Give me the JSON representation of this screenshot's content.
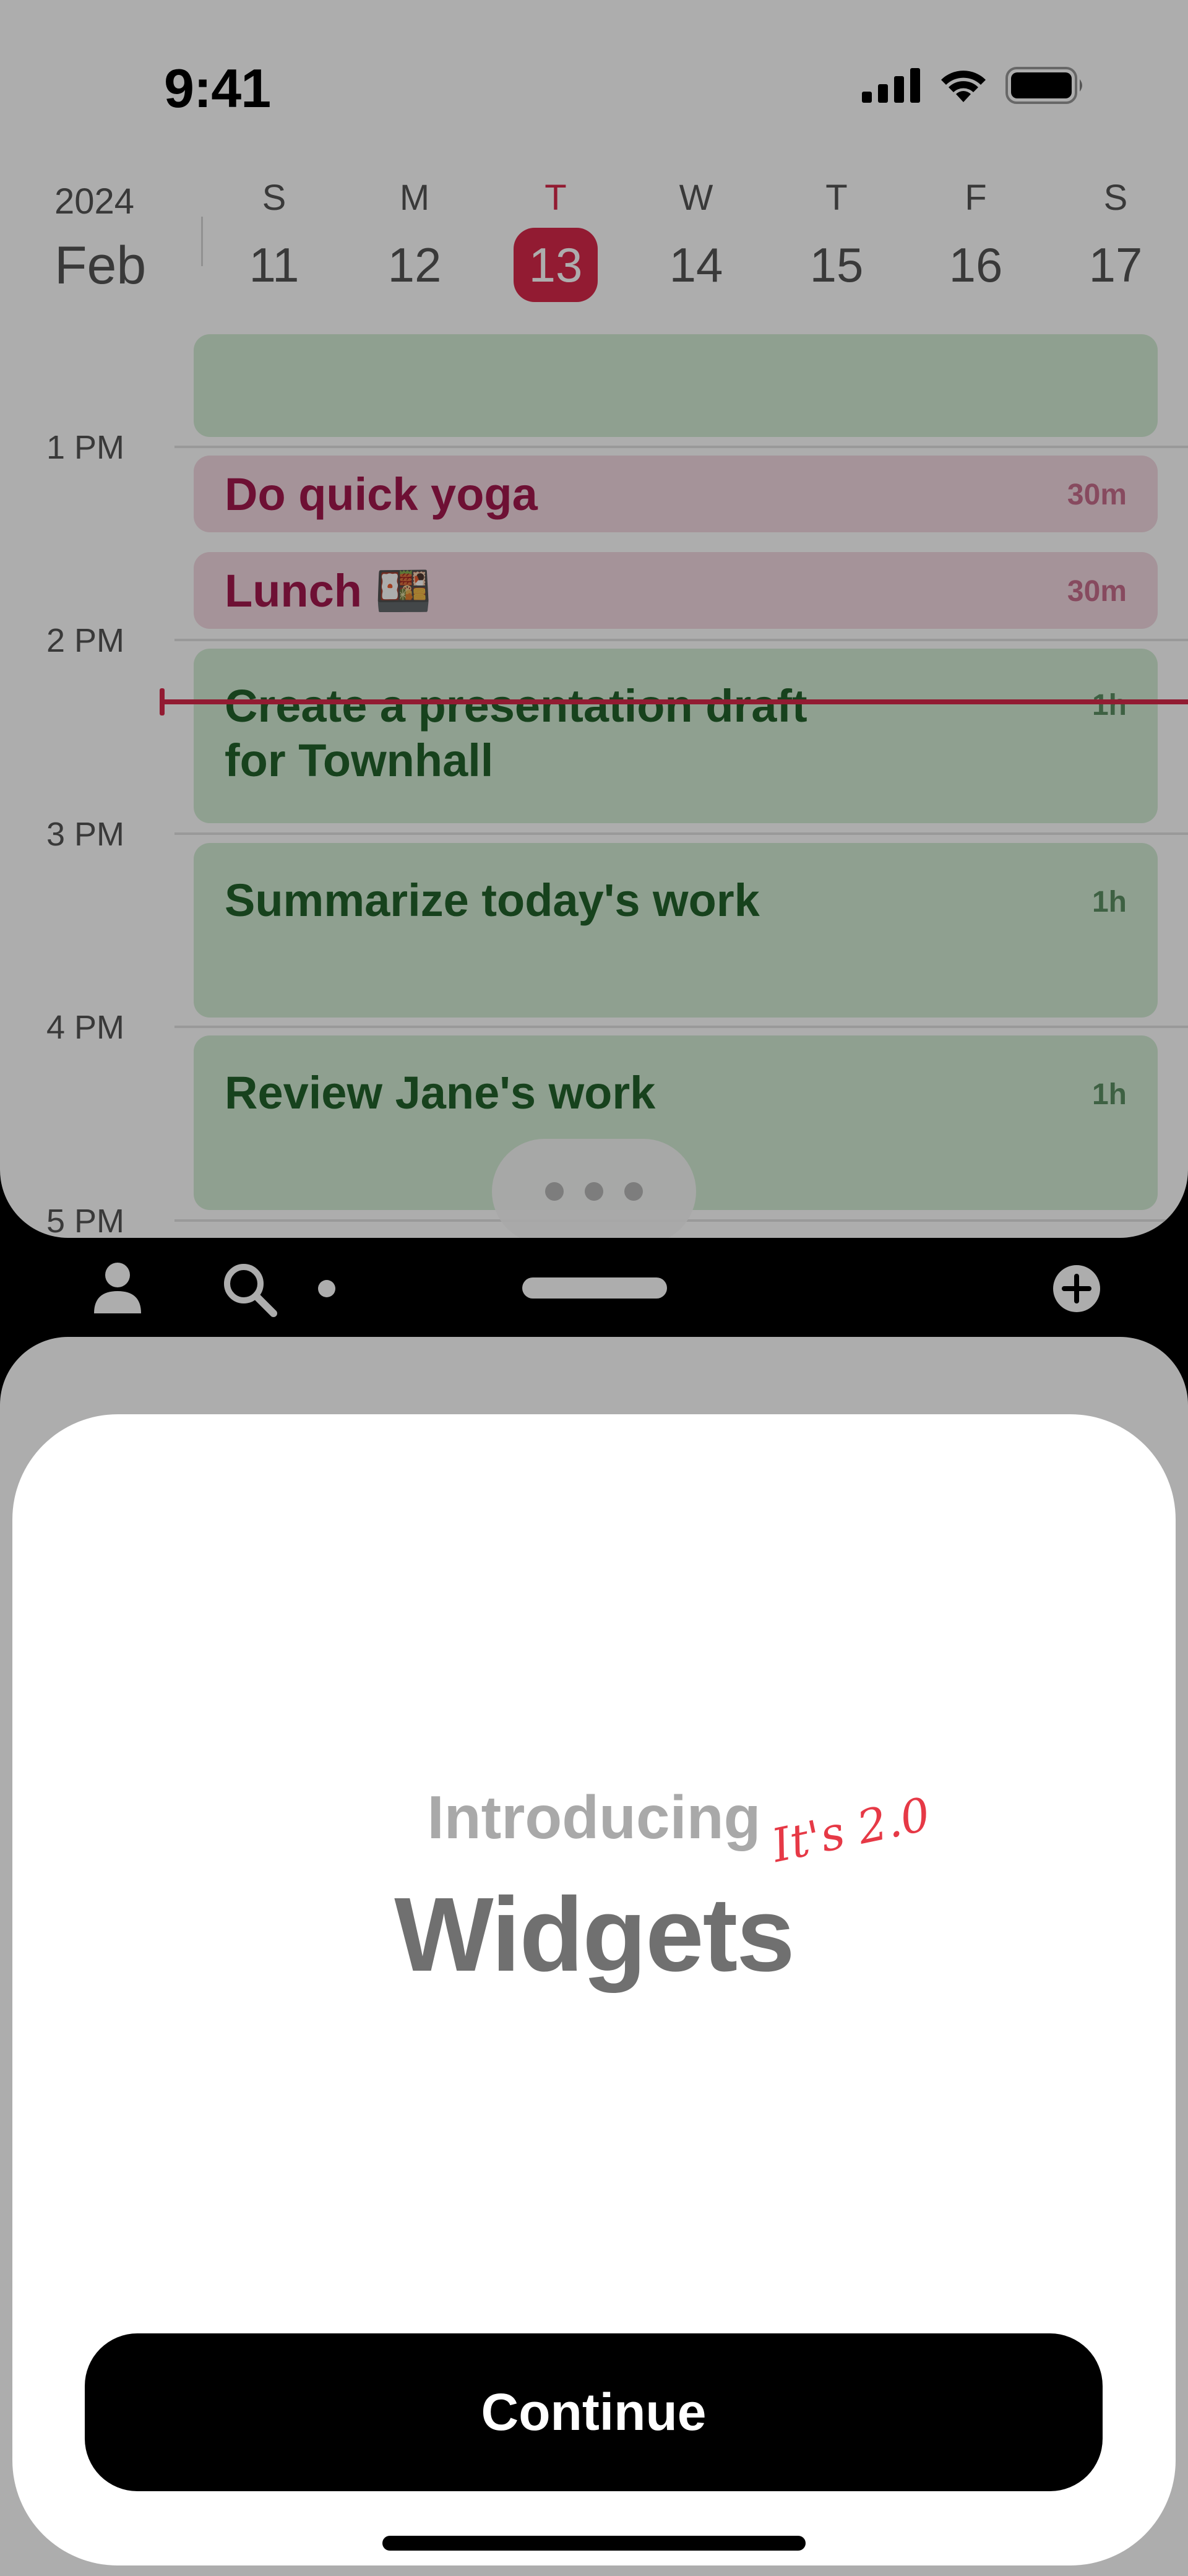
{
  "status_bar": {
    "time": "9:41"
  },
  "calendar": {
    "year": "2024",
    "month": "Feb",
    "days": [
      {
        "letter": "S",
        "num": "11"
      },
      {
        "letter": "M",
        "num": "12"
      },
      {
        "letter": "T",
        "num": "13"
      },
      {
        "letter": "W",
        "num": "14"
      },
      {
        "letter": "T",
        "num": "15"
      },
      {
        "letter": "F",
        "num": "16"
      },
      {
        "letter": "S",
        "num": "17"
      }
    ],
    "today_index": 2,
    "hours": [
      "1 PM",
      "2 PM",
      "3 PM",
      "4 PM",
      "5 PM"
    ],
    "events": [
      {
        "title": "",
        "duration": "",
        "color": "green"
      },
      {
        "title": "Do quick yoga",
        "duration": "30m",
        "color": "pink"
      },
      {
        "title": "Lunch 🍱",
        "duration": "30m",
        "color": "pink"
      },
      {
        "title": "Create a presentation draft for Townhall",
        "title_line1": "Create a presentation draft",
        "title_line2": "for Townhall",
        "duration": "1h",
        "color": "green"
      },
      {
        "title": "Summarize today's work",
        "duration": "1h",
        "color": "green"
      },
      {
        "title": "Review Jane's work",
        "duration": "1h",
        "color": "green"
      }
    ]
  },
  "toolbar": {
    "icons": [
      "person-icon",
      "search-icon",
      "add-icon"
    ]
  },
  "sheet": {
    "intro": "Introducing",
    "title": "Widgets",
    "version_note": "It's 2.0",
    "continue_label": "Continue"
  },
  "colors": {
    "accent": "#d8294a",
    "event_green": "#d3ecd4",
    "event_pink": "#f3d9e2",
    "version_note": "#e63946"
  }
}
